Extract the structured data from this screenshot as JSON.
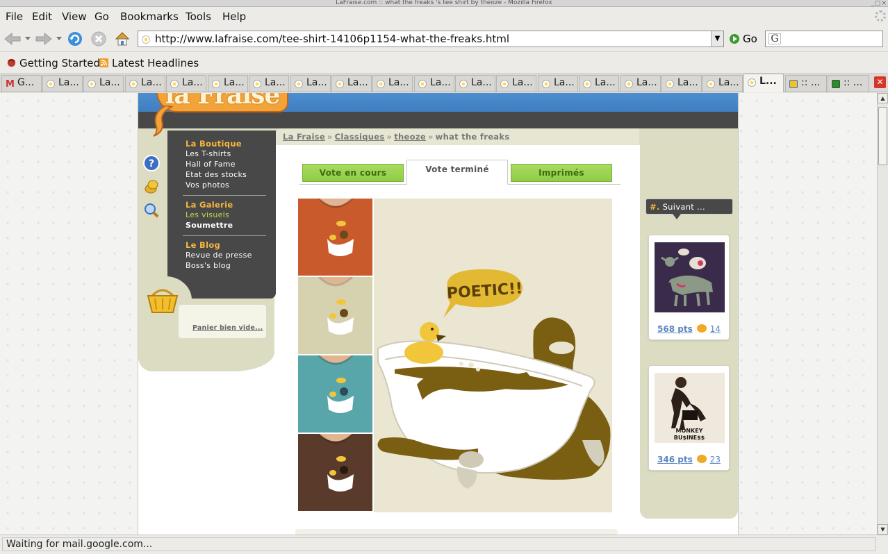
{
  "window": {
    "title": "LaFraise.com :: what the freaks 's tee shirt by theoze - Mozilla Firefox"
  },
  "menu": [
    "File",
    "Edit",
    "View",
    "Go",
    "Bookmarks",
    "Tools",
    "Help"
  ],
  "navigation": {
    "url": "http://www.lafraise.com/tee-shirt-14106p1154-what-the-freaks.html",
    "go_label": "Go",
    "search_value": ""
  },
  "bookmarks": [
    "Getting Started",
    "Latest Headlines"
  ],
  "tabs": [
    {
      "label": "G...",
      "icon": "gmail-icon"
    },
    {
      "label": "La..."
    },
    {
      "label": "La..."
    },
    {
      "label": "La..."
    },
    {
      "label": "La..."
    },
    {
      "label": "La..."
    },
    {
      "label": "La..."
    },
    {
      "label": "La..."
    },
    {
      "label": "La..."
    },
    {
      "label": "La..."
    },
    {
      "label": "La..."
    },
    {
      "label": "La..."
    },
    {
      "label": "La..."
    },
    {
      "label": "La..."
    },
    {
      "label": "La..."
    },
    {
      "label": "La..."
    },
    {
      "label": "La..."
    },
    {
      "label": "L...",
      "active": true
    },
    {
      "label": ":: ..."
    },
    {
      "label": ":: ..."
    }
  ],
  "site": {
    "logo_text": "la Fraise",
    "left_menu": {
      "boutique_title": "La Boutique",
      "boutique_items": [
        "Les T-shirts",
        "Hall of Fame",
        "Etat des stocks",
        "Vos photos"
      ],
      "galerie_title": "La Galerie",
      "galerie_items": [
        "Les visuels",
        "Soumettre"
      ],
      "blog_title": "Le Blog",
      "blog_items": [
        "Revue de presse",
        "Boss's blog"
      ]
    },
    "basket_link": "Panier bien vide...",
    "breadcrumb": {
      "home": "La Fraise",
      "category": "Classiques",
      "artist": "theoze",
      "current": "what the freaks",
      "separator": "»"
    },
    "vote_tabs": {
      "in_progress": "Vote en cours",
      "finished": "Vote terminé",
      "printed": "Imprimés"
    },
    "product": {
      "bubble_text": "POETIC!!",
      "shirt_colors": [
        "#c95a2c",
        "#d6d2b0",
        "#58a5aa",
        "#5a3a2a"
      ]
    },
    "next": {
      "title_prefix": "#.",
      "title": "Suivant ...",
      "items": [
        {
          "points": "568",
          "points_unit": "pts",
          "comments": "14"
        },
        {
          "points": "346",
          "points_unit": "pts",
          "comments": "23",
          "image_text": "MONKEY BU$INE$$"
        }
      ]
    }
  },
  "status": "Waiting for mail.google.com..."
}
